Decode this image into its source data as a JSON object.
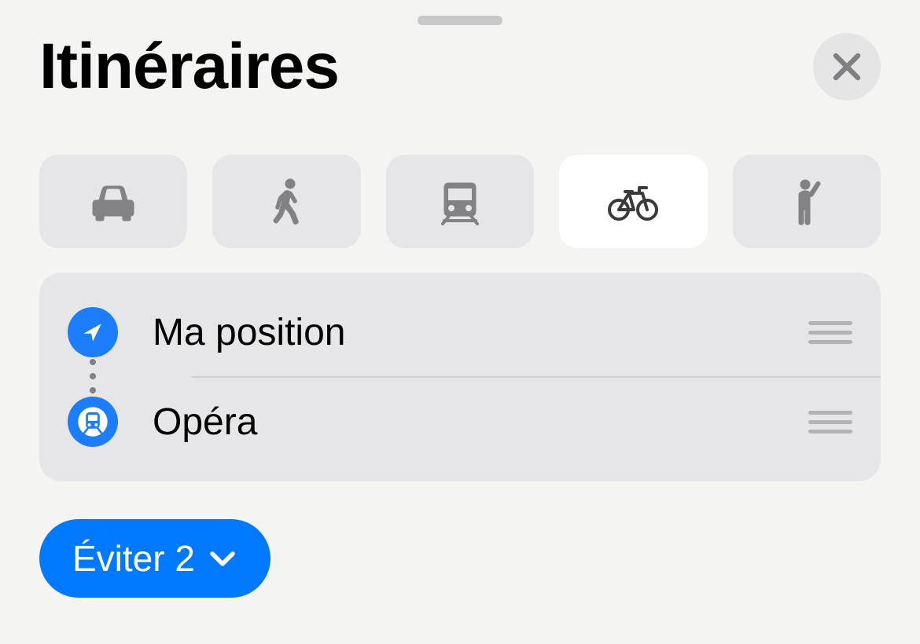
{
  "header": {
    "title": "Itinéraires"
  },
  "transport_modes": [
    {
      "name": "car",
      "selected": false
    },
    {
      "name": "walk",
      "selected": false
    },
    {
      "name": "transit",
      "selected": false
    },
    {
      "name": "bike",
      "selected": true
    },
    {
      "name": "rideshare",
      "selected": false
    }
  ],
  "route": {
    "origin": {
      "label": "Ma position"
    },
    "destination": {
      "label": "Opéra"
    }
  },
  "options": {
    "avoid_label": "Éviter 2"
  }
}
